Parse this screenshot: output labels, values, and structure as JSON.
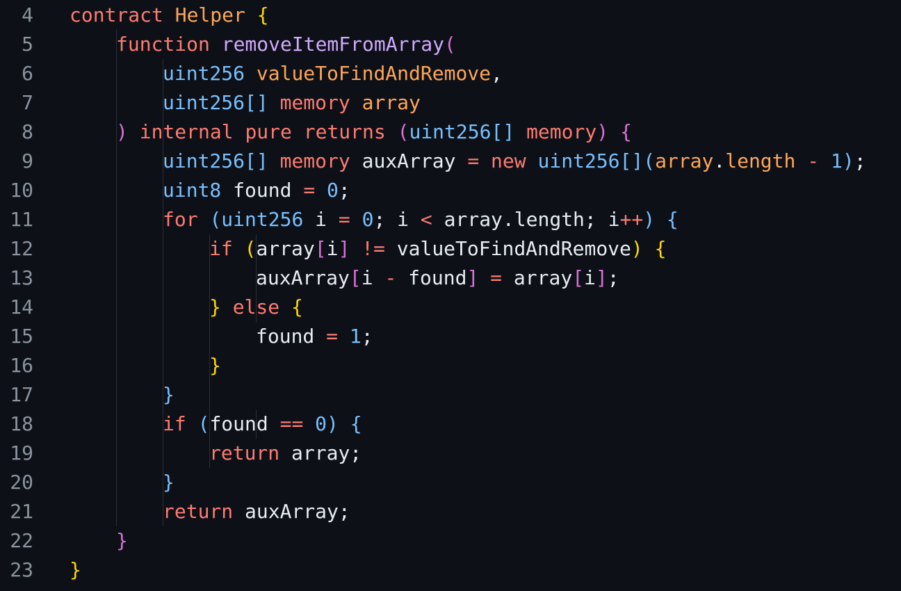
{
  "colors": {
    "background": "#0d1117",
    "line_number": "#8b949e",
    "keyword": "#ff7b72",
    "contract_name": "#ffa657",
    "function_name": "#d2a8ff",
    "type": "#79c0ff",
    "param": "#ffa657",
    "plain": "#e6edf3",
    "bracket_gold": "#ffd700",
    "bracket_pink": "#da70d6",
    "bracket_blue": "#179fff",
    "indent_guide": "#2b3036"
  },
  "lines": [
    {
      "num": "4",
      "indent": 0,
      "tokens": [
        {
          "t": "contract",
          "c": "keyword"
        },
        {
          "t": " "
        },
        {
          "t": "Helper",
          "c": "contract_name"
        },
        {
          "t": " "
        },
        {
          "t": "{",
          "c": "bracket_gold"
        }
      ]
    },
    {
      "num": "5",
      "indent": 1,
      "tokens": [
        {
          "t": "function",
          "c": "keyword"
        },
        {
          "t": " "
        },
        {
          "t": "removeItemFromArray",
          "c": "function_name"
        },
        {
          "t": "(",
          "c": "bracket_pink"
        }
      ]
    },
    {
      "num": "6",
      "indent": 2,
      "tokens": [
        {
          "t": "uint256",
          "c": "type"
        },
        {
          "t": " "
        },
        {
          "t": "valueToFindAndRemove",
          "c": "param"
        },
        {
          "t": ","
        }
      ]
    },
    {
      "num": "7",
      "indent": 2,
      "tokens": [
        {
          "t": "uint256",
          "c": "type"
        },
        {
          "t": "[]",
          "c": "type"
        },
        {
          "t": " "
        },
        {
          "t": "memory",
          "c": "keyword"
        },
        {
          "t": " "
        },
        {
          "t": "array",
          "c": "param"
        }
      ]
    },
    {
      "num": "8",
      "indent": 1,
      "tokens": [
        {
          "t": ")",
          "c": "bracket_pink"
        },
        {
          "t": " "
        },
        {
          "t": "internal",
          "c": "keyword"
        },
        {
          "t": " "
        },
        {
          "t": "pure",
          "c": "keyword"
        },
        {
          "t": " "
        },
        {
          "t": "returns",
          "c": "keyword"
        },
        {
          "t": " "
        },
        {
          "t": "(",
          "c": "bracket_pink"
        },
        {
          "t": "uint256",
          "c": "type"
        },
        {
          "t": "[]",
          "c": "type"
        },
        {
          "t": " "
        },
        {
          "t": "memory",
          "c": "keyword"
        },
        {
          "t": ")",
          "c": "bracket_pink"
        },
        {
          "t": " "
        },
        {
          "t": "{",
          "c": "bracket_pink"
        }
      ]
    },
    {
      "num": "9",
      "indent": 2,
      "tokens": [
        {
          "t": "uint256",
          "c": "type"
        },
        {
          "t": "[]",
          "c": "type"
        },
        {
          "t": " "
        },
        {
          "t": "memory",
          "c": "keyword"
        },
        {
          "t": " auxArray "
        },
        {
          "t": "=",
          "c": "keyword"
        },
        {
          "t": " "
        },
        {
          "t": "new",
          "c": "keyword"
        },
        {
          "t": " "
        },
        {
          "t": "uint256",
          "c": "type"
        },
        {
          "t": "[]",
          "c": "type"
        },
        {
          "t": "(",
          "c": "type"
        },
        {
          "t": "array",
          "c": "param"
        },
        {
          "t": "."
        },
        {
          "t": "length",
          "c": "param"
        },
        {
          "t": " "
        },
        {
          "t": "-",
          "c": "keyword"
        },
        {
          "t": " "
        },
        {
          "t": "1",
          "c": "type"
        },
        {
          "t": ")",
          "c": "type"
        },
        {
          "t": ";"
        }
      ]
    },
    {
      "num": "10",
      "indent": 2,
      "tokens": [
        {
          "t": "uint8",
          "c": "type"
        },
        {
          "t": " found "
        },
        {
          "t": "=",
          "c": "keyword"
        },
        {
          "t": " "
        },
        {
          "t": "0",
          "c": "type"
        },
        {
          "t": ";"
        }
      ]
    },
    {
      "num": "11",
      "indent": 2,
      "tokens": [
        {
          "t": "for",
          "c": "keyword"
        },
        {
          "t": " "
        },
        {
          "t": "(",
          "c": "type"
        },
        {
          "t": "uint256",
          "c": "type"
        },
        {
          "t": " i "
        },
        {
          "t": "=",
          "c": "keyword"
        },
        {
          "t": " "
        },
        {
          "t": "0",
          "c": "type"
        },
        {
          "t": "; i "
        },
        {
          "t": "<",
          "c": "keyword"
        },
        {
          "t": " array.length; i"
        },
        {
          "t": "++",
          "c": "keyword"
        },
        {
          "t": ")",
          "c": "type"
        },
        {
          "t": " "
        },
        {
          "t": "{",
          "c": "type"
        }
      ]
    },
    {
      "num": "12",
      "indent": 3,
      "tokens": [
        {
          "t": "if",
          "c": "keyword"
        },
        {
          "t": " "
        },
        {
          "t": "(",
          "c": "bracket_gold"
        },
        {
          "t": "array"
        },
        {
          "t": "[",
          "c": "bracket_pink"
        },
        {
          "t": "i"
        },
        {
          "t": "]",
          "c": "bracket_pink"
        },
        {
          "t": " "
        },
        {
          "t": "!=",
          "c": "keyword"
        },
        {
          "t": " valueToFindAndRemove"
        },
        {
          "t": ")",
          "c": "bracket_gold"
        },
        {
          "t": " "
        },
        {
          "t": "{",
          "c": "bracket_gold"
        }
      ]
    },
    {
      "num": "13",
      "indent": 4,
      "tokens": [
        {
          "t": "auxArray"
        },
        {
          "t": "[",
          "c": "bracket_pink"
        },
        {
          "t": "i "
        },
        {
          "t": "-",
          "c": "keyword"
        },
        {
          "t": " found"
        },
        {
          "t": "]",
          "c": "bracket_pink"
        },
        {
          "t": " "
        },
        {
          "t": "=",
          "c": "keyword"
        },
        {
          "t": " array"
        },
        {
          "t": "[",
          "c": "bracket_pink"
        },
        {
          "t": "i"
        },
        {
          "t": "]",
          "c": "bracket_pink"
        },
        {
          "t": ";"
        }
      ]
    },
    {
      "num": "14",
      "indent": 3,
      "tokens": [
        {
          "t": "}",
          "c": "bracket_gold"
        },
        {
          "t": " "
        },
        {
          "t": "else",
          "c": "keyword"
        },
        {
          "t": " "
        },
        {
          "t": "{",
          "c": "bracket_gold"
        }
      ]
    },
    {
      "num": "15",
      "indent": 4,
      "tokens": [
        {
          "t": "found "
        },
        {
          "t": "=",
          "c": "keyword"
        },
        {
          "t": " "
        },
        {
          "t": "1",
          "c": "type"
        },
        {
          "t": ";"
        }
      ]
    },
    {
      "num": "16",
      "indent": 3,
      "tokens": [
        {
          "t": "}",
          "c": "bracket_gold"
        }
      ]
    },
    {
      "num": "17",
      "indent": 2,
      "tokens": [
        {
          "t": "}",
          "c": "type"
        }
      ]
    },
    {
      "num": "18",
      "indent": 2,
      "tokens": [
        {
          "t": "if",
          "c": "keyword"
        },
        {
          "t": " "
        },
        {
          "t": "(",
          "c": "type"
        },
        {
          "t": "found "
        },
        {
          "t": "==",
          "c": "keyword"
        },
        {
          "t": " "
        },
        {
          "t": "0",
          "c": "type"
        },
        {
          "t": ")",
          "c": "type"
        },
        {
          "t": " "
        },
        {
          "t": "{",
          "c": "type"
        }
      ]
    },
    {
      "num": "19",
      "indent": 3,
      "tokens": [
        {
          "t": "return",
          "c": "keyword"
        },
        {
          "t": " array;"
        }
      ]
    },
    {
      "num": "20",
      "indent": 2,
      "tokens": [
        {
          "t": "}",
          "c": "type"
        }
      ]
    },
    {
      "num": "21",
      "indent": 2,
      "tokens": [
        {
          "t": "return",
          "c": "keyword"
        },
        {
          "t": " auxArray;"
        }
      ]
    },
    {
      "num": "22",
      "indent": 1,
      "tokens": [
        {
          "t": "}",
          "c": "bracket_pink"
        }
      ]
    },
    {
      "num": "23",
      "indent": 0,
      "tokens": [
        {
          "t": "}",
          "c": "bracket_gold"
        }
      ]
    }
  ]
}
